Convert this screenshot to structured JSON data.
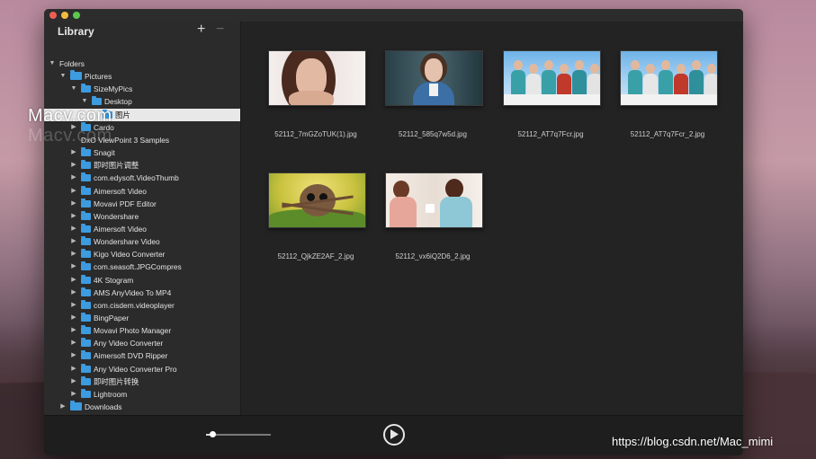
{
  "sidebar": {
    "title": "Library",
    "add_label": "+",
    "remove_label": "−",
    "tree": [
      {
        "label": "Folders",
        "level": 0,
        "disc": "▼",
        "icon": false
      },
      {
        "label": "Pictures",
        "level": 1,
        "disc": "▼",
        "icon": true,
        "big": true
      },
      {
        "label": "SizeMyPics",
        "level": 2,
        "disc": "▼",
        "icon": true
      },
      {
        "label": "Desktop",
        "level": 3,
        "disc": "▼",
        "icon": true
      },
      {
        "label": "图片",
        "level": 4,
        "disc": "",
        "icon": true,
        "selected": true
      },
      {
        "label": "Cardo",
        "level": 2,
        "disc": "▶",
        "icon": true
      },
      {
        "label": "DxO ViewPoint 3 Samples",
        "level": 2,
        "disc": "",
        "icon": false
      },
      {
        "label": "Snagit",
        "level": 2,
        "disc": "▶",
        "icon": true
      },
      {
        "label": "即时图片调整",
        "level": 2,
        "disc": "▶",
        "icon": true
      },
      {
        "label": "com.edysoft.VideoThumb",
        "level": 2,
        "disc": "▶",
        "icon": true
      },
      {
        "label": "Aimersoft Video",
        "level": 2,
        "disc": "▶",
        "icon": true
      },
      {
        "label": "Movavi PDF Editor",
        "level": 2,
        "disc": "▶",
        "icon": true
      },
      {
        "label": "Wondershare",
        "level": 2,
        "disc": "▶",
        "icon": true
      },
      {
        "label": "Aimersoft Video",
        "level": 2,
        "disc": "▶",
        "icon": true
      },
      {
        "label": "Wondershare Video",
        "level": 2,
        "disc": "▶",
        "icon": true
      },
      {
        "label": "Kigo Video Converter",
        "level": 2,
        "disc": "▶",
        "icon": true
      },
      {
        "label": "com.seasoft.JPGCompres",
        "level": 2,
        "disc": "▶",
        "icon": true
      },
      {
        "label": "4K Stogram",
        "level": 2,
        "disc": "▶",
        "icon": true
      },
      {
        "label": "AMS AnyVideo To MP4",
        "level": 2,
        "disc": "▶",
        "icon": true
      },
      {
        "label": "com.cisdem.videoplayer",
        "level": 2,
        "disc": "▶",
        "icon": true
      },
      {
        "label": "BingPaper",
        "level": 2,
        "disc": "▶",
        "icon": true
      },
      {
        "label": "Movavi Photo Manager",
        "level": 2,
        "disc": "▶",
        "icon": true
      },
      {
        "label": "Any Video Converter",
        "level": 2,
        "disc": "▶",
        "icon": true
      },
      {
        "label": "Aimersoft DVD Ripper",
        "level": 2,
        "disc": "▶",
        "icon": true
      },
      {
        "label": "Any Video Converter Pro",
        "level": 2,
        "disc": "▶",
        "icon": true
      },
      {
        "label": "即时图片转换",
        "level": 2,
        "disc": "▶",
        "icon": true
      },
      {
        "label": "Lightroom",
        "level": 2,
        "disc": "▶",
        "icon": true
      },
      {
        "label": "Downloads",
        "level": 1,
        "disc": "▶",
        "icon": true,
        "big": true
      }
    ]
  },
  "thumbnails": [
    {
      "caption": "52112_7mGZoTUK(1).jpg",
      "art": "portrait-woman-icon"
    },
    {
      "caption": "52112_585q7w5d.jpg",
      "art": "portrait-woman-denim-icon"
    },
    {
      "caption": "52112_AT7q7Fcr.jpg",
      "art": "group-photo-icon"
    },
    {
      "caption": "52112_AT7q7Fcr_2.jpg",
      "art": "group-photo-icon"
    },
    {
      "caption": "52112_QjkZE2AF_2.jpg",
      "art": "spider-macro-icon"
    },
    {
      "caption": "52112_vx6iQ2D6_2.jpg",
      "art": "two-women-cafe-icon"
    }
  ],
  "bottombar": {
    "zoom_level": 0.1,
    "play_icon": "play-circle-icon"
  },
  "watermark": {
    "main": "Macv.com",
    "echo": "Macv.com",
    "url": "https://blog.csdn.net/Mac_mimi"
  }
}
